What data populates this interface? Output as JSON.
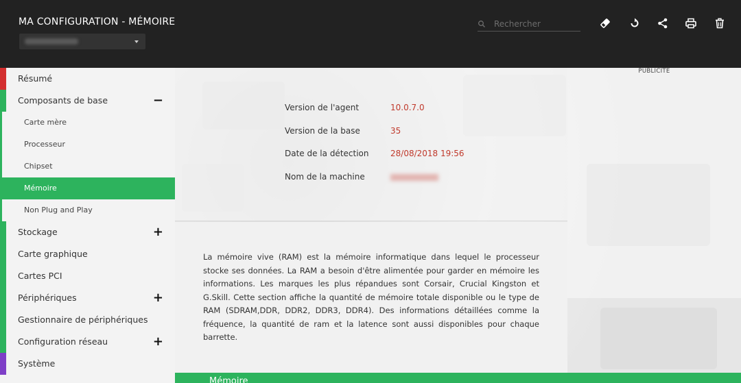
{
  "header": {
    "title": "MA CONFIGURATION - MÉMOIRE",
    "search_placeholder": "Rechercher",
    "tools": [
      "eraser-icon",
      "refresh-icon",
      "share-icon",
      "print-icon",
      "trash-icon"
    ]
  },
  "colors": {
    "header_bg": "#222222",
    "accent_green": "#2db35d",
    "red": "#c0392b",
    "purple": "#7e3fc7"
  },
  "sidebar": {
    "summary": "Résumé",
    "base": "Composants de base",
    "sub": [
      "Carte mère",
      "Processeur",
      "Chipset",
      "Mémoire",
      "Non Plug and Play"
    ],
    "storage": "Stockage",
    "graphics": "Carte graphique",
    "pci": "Cartes PCI",
    "peripherals": "Périphériques",
    "device_manager": "Gestionnaire de périphériques",
    "network": "Configuration réseau",
    "system": "Système",
    "toggle_minus": "−",
    "toggle_plus": "+"
  },
  "info": {
    "agent_label": "Version de l'agent",
    "agent_value": "10.0.7.0",
    "base_label": "Version de la base",
    "base_value": "35",
    "date_label": "Date de la détection",
    "date_value": "28/08/2018 19:56",
    "machine_label": "Nom de la machine"
  },
  "ad": {
    "label": "PUBLICITÉ"
  },
  "description": "La mémoire vive (RAM) est la mémoire informatique dans lequel le processeur stocke ses données. La RAM a besoin d'être alimentée pour garder en mémoire les informations. Les marques les plus répandues sont Corsair, Crucial Kingston et G.Skill. Cette section affiche la quantité de mémoire totale disponible ou le type de RAM (SDRAM,DDR, DDR2, DDR3, DDR4). Des informations détaillées comme la fréquence, la quantité de ram et la latence sont aussi disponibles pour chaque barrette.",
  "section": {
    "title": "Mémoire"
  }
}
